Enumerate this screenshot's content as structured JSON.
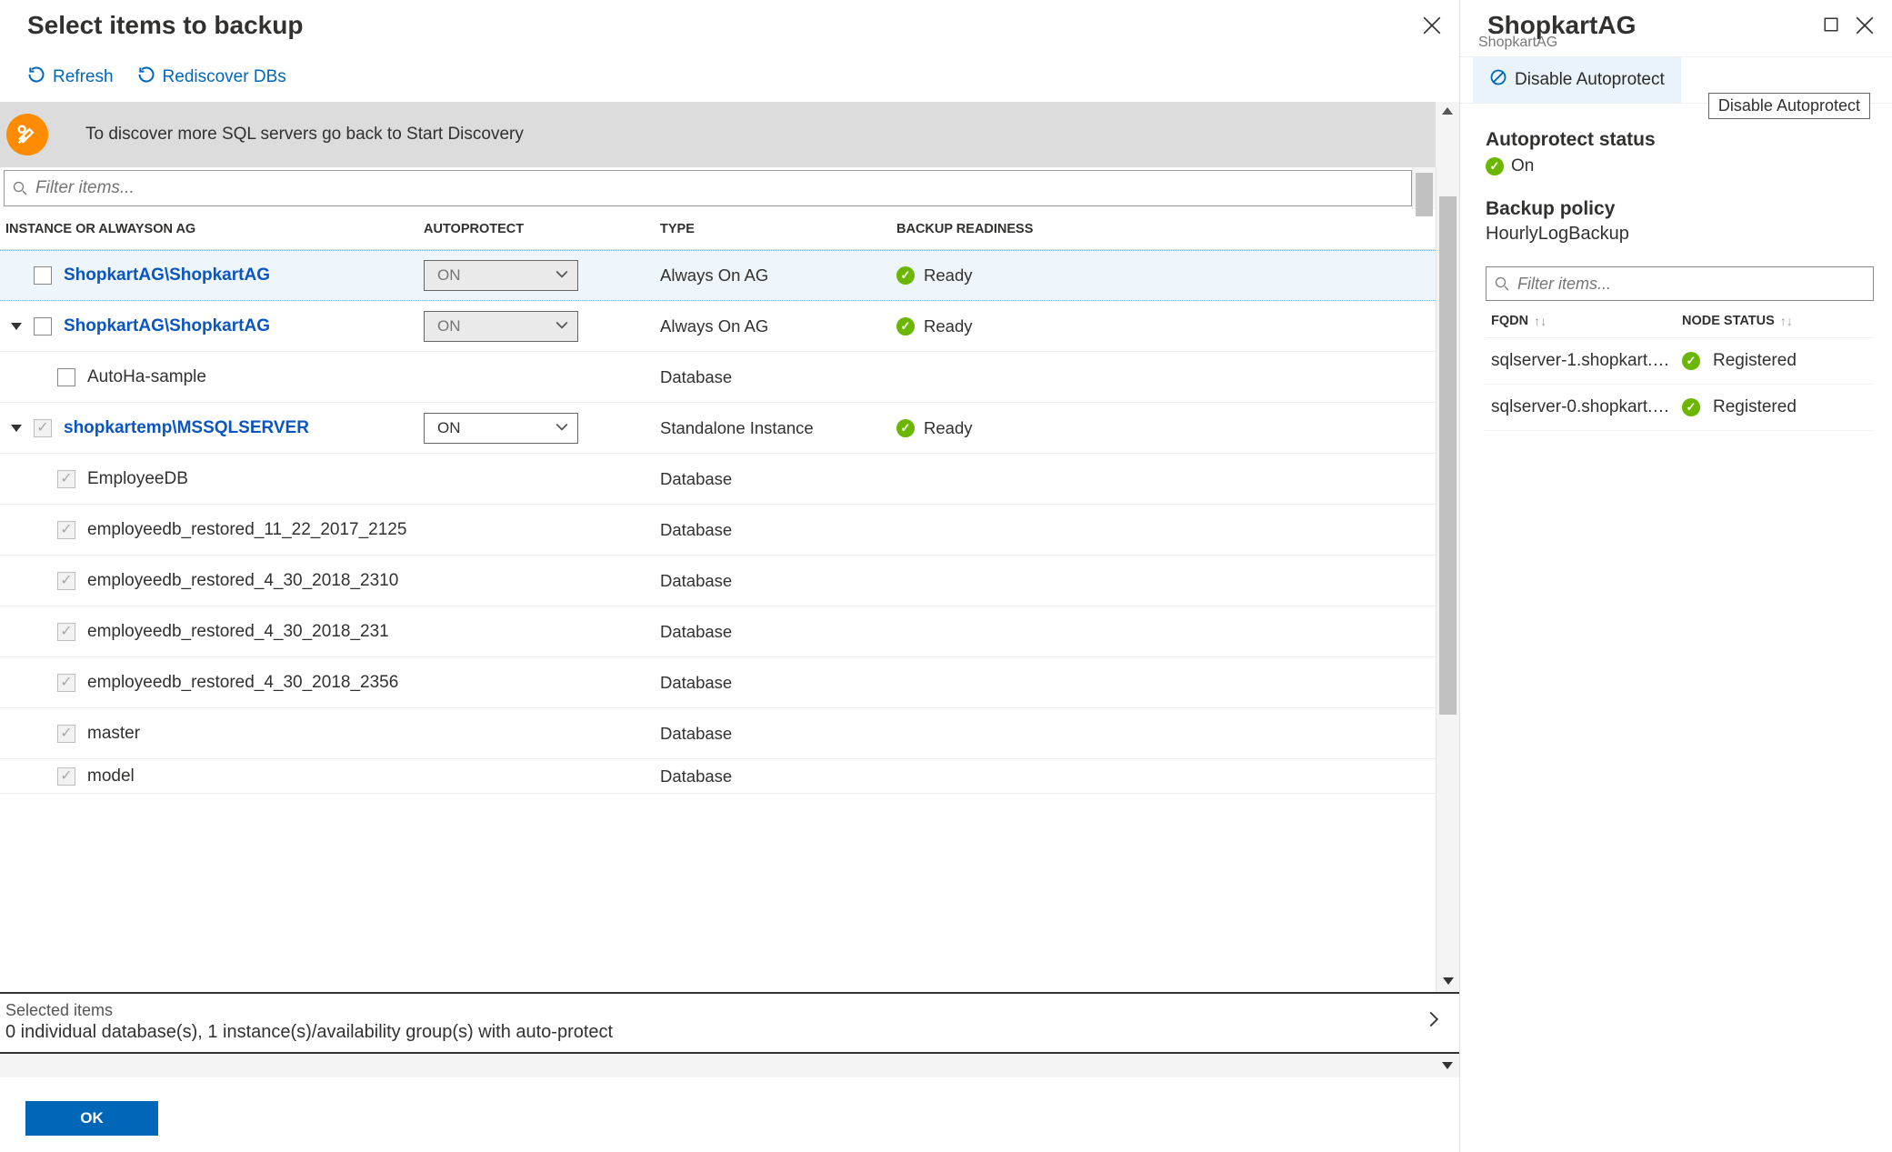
{
  "left": {
    "title": "Select items to backup",
    "toolbar": {
      "refresh": "Refresh",
      "rediscover": "Rediscover DBs"
    },
    "banner": "To discover more SQL servers go back to Start Discovery",
    "filter_placeholder": "Filter items...",
    "columns": {
      "instance": "INSTANCE OR ALWAYSON AG",
      "autoprotect": "AUTOPROTECT",
      "type": "TYPE",
      "readiness": "BACKUP READINESS"
    },
    "rows": [
      {
        "name": "ShopkartAG\\ShopkartAG",
        "link": true,
        "auto": "ON",
        "auto_disabled": true,
        "type": "Always On AG",
        "ready": "Ready",
        "cb": "unchecked",
        "arrow": null,
        "highlight": true,
        "indent": 1
      },
      {
        "name": "ShopkartAG\\ShopkartAG",
        "link": true,
        "auto": "ON",
        "auto_disabled": true,
        "type": "Always On AG",
        "ready": "Ready",
        "cb": "unchecked",
        "arrow": "down",
        "indent": 1
      },
      {
        "name": "AutoHa-sample",
        "link": false,
        "auto": null,
        "type": "Database",
        "ready": null,
        "cb": "unchecked",
        "arrow": null,
        "indent": 2
      },
      {
        "name": "shopkartemp\\MSSQLSERVER",
        "link": true,
        "auto": "ON",
        "auto_disabled": false,
        "type": "Standalone Instance",
        "ready": "Ready",
        "cb": "checked-disabled",
        "arrow": "down",
        "indent": 1
      },
      {
        "name": "EmployeeDB",
        "link": false,
        "auto": null,
        "type": "Database",
        "ready": null,
        "cb": "checked-disabled",
        "indent": 2
      },
      {
        "name": "employeedb_restored_11_22_2017_2125",
        "link": false,
        "auto": null,
        "type": "Database",
        "ready": null,
        "cb": "checked-disabled",
        "indent": 2
      },
      {
        "name": "employeedb_restored_4_30_2018_2310",
        "link": false,
        "auto": null,
        "type": "Database",
        "ready": null,
        "cb": "checked-disabled",
        "indent": 2
      },
      {
        "name": "employeedb_restored_4_30_2018_231",
        "link": false,
        "auto": null,
        "type": "Database",
        "ready": null,
        "cb": "checked-disabled",
        "indent": 2
      },
      {
        "name": "employeedb_restored_4_30_2018_2356",
        "link": false,
        "auto": null,
        "type": "Database",
        "ready": null,
        "cb": "checked-disabled",
        "indent": 2
      },
      {
        "name": "master",
        "link": false,
        "auto": null,
        "type": "Database",
        "ready": null,
        "cb": "checked-disabled",
        "indent": 2
      },
      {
        "name": "model",
        "link": false,
        "auto": null,
        "type": "Database",
        "ready": null,
        "cb": "checked-disabled",
        "indent": 2,
        "partial": true
      }
    ],
    "selected": {
      "label": "Selected items",
      "detail": "0 individual database(s), 1 instance(s)/availability group(s) with auto-protect"
    },
    "ok": "OK"
  },
  "right": {
    "title": "ShopkartAG",
    "subtitle": "ShopkartAG",
    "cmd": "Disable Autoprotect",
    "tooltip": "Disable Autoprotect",
    "status_label": "Autoprotect status",
    "status_value": "On",
    "policy_label": "Backup policy",
    "policy_value": "HourlyLogBackup",
    "filter_placeholder": "Filter items...",
    "columns": {
      "fqdn": "FQDN",
      "node": "NODE STATUS"
    },
    "nodes": [
      {
        "fqdn": "sqlserver-1.shopkart.…",
        "status": "Registered"
      },
      {
        "fqdn": "sqlserver-0.shopkart.…",
        "status": "Registered"
      }
    ]
  }
}
